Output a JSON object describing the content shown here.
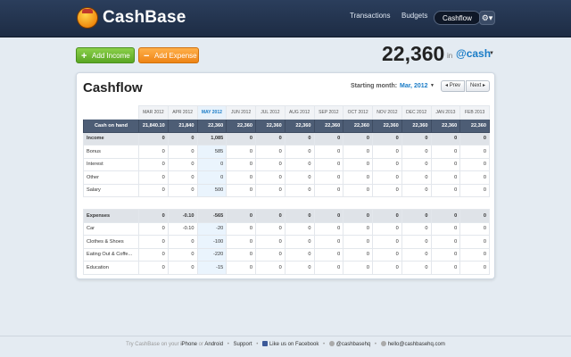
{
  "header": {
    "brand": "CashBase",
    "nav": {
      "transactions": "Transactions",
      "budgets": "Budgets",
      "cashflow": "Cashflow"
    },
    "gear_icon": "gear-icon"
  },
  "actions": {
    "add_income": "Add Income",
    "add_expense": "Add Expense"
  },
  "balance": {
    "amount": "22,360",
    "in_label": "in",
    "account": "@cash"
  },
  "cashflow": {
    "title": "Cashflow",
    "starting_month_label": "Starting month:",
    "starting_month_value": "Mar, 2012",
    "prev_label": "Prev",
    "next_label": "Next",
    "months": [
      "MAR 2012",
      "APR 2012",
      "MAY 2012",
      "JUN 2012",
      "JUL 2012",
      "AUG 2012",
      "SEP 2012",
      "OCT 2012",
      "NOV 2012",
      "DEC 2012",
      "JAN 2013",
      "FEB 2013"
    ],
    "cash_on_hand": {
      "label": "Cash on hand",
      "values": [
        "21,840.10",
        "21,840",
        "22,360",
        "22,360",
        "22,360",
        "22,360",
        "22,360",
        "22,360",
        "22,360",
        "22,360",
        "22,360",
        "22,360"
      ]
    },
    "income": {
      "label": "Income",
      "totals": [
        "0",
        "0",
        "1,085",
        "0",
        "0",
        "0",
        "0",
        "0",
        "0",
        "0",
        "0",
        "0"
      ],
      "rows": [
        {
          "label": "Bonus",
          "values": [
            "0",
            "0",
            "585",
            "0",
            "0",
            "0",
            "0",
            "0",
            "0",
            "0",
            "0",
            "0"
          ]
        },
        {
          "label": "Interest",
          "values": [
            "0",
            "0",
            "0",
            "0",
            "0",
            "0",
            "0",
            "0",
            "0",
            "0",
            "0",
            "0"
          ]
        },
        {
          "label": "Other",
          "values": [
            "0",
            "0",
            "0",
            "0",
            "0",
            "0",
            "0",
            "0",
            "0",
            "0",
            "0",
            "0"
          ]
        },
        {
          "label": "Salary",
          "values": [
            "0",
            "0",
            "500",
            "0",
            "0",
            "0",
            "0",
            "0",
            "0",
            "0",
            "0",
            "0"
          ]
        }
      ]
    },
    "expenses": {
      "label": "Expenses",
      "totals": [
        "0",
        "-0.10",
        "-565",
        "0",
        "0",
        "0",
        "0",
        "0",
        "0",
        "0",
        "0",
        "0"
      ],
      "rows": [
        {
          "label": "Car",
          "values": [
            "0",
            "-0.10",
            "-20",
            "0",
            "0",
            "0",
            "0",
            "0",
            "0",
            "0",
            "0",
            "0"
          ]
        },
        {
          "label": "Clothes & Shoes",
          "values": [
            "0",
            "0",
            "-100",
            "0",
            "0",
            "0",
            "0",
            "0",
            "0",
            "0",
            "0",
            "0"
          ]
        },
        {
          "label": "Eating Out & Coffe...",
          "values": [
            "0",
            "0",
            "-220",
            "0",
            "0",
            "0",
            "0",
            "0",
            "0",
            "0",
            "0",
            "0"
          ]
        },
        {
          "label": "Education",
          "values": [
            "0",
            "0",
            "-15",
            "0",
            "0",
            "0",
            "0",
            "0",
            "0",
            "0",
            "0",
            "0"
          ]
        }
      ]
    }
  },
  "footer": {
    "try_text": "Try CashBase on your",
    "iphone": "iPhone",
    "or": "or",
    "android": "Android",
    "support": "Support",
    "facebook": "Like us on Facebook",
    "twitter": "@cashbasehq",
    "email": "hello@cashbasehq.com"
  }
}
